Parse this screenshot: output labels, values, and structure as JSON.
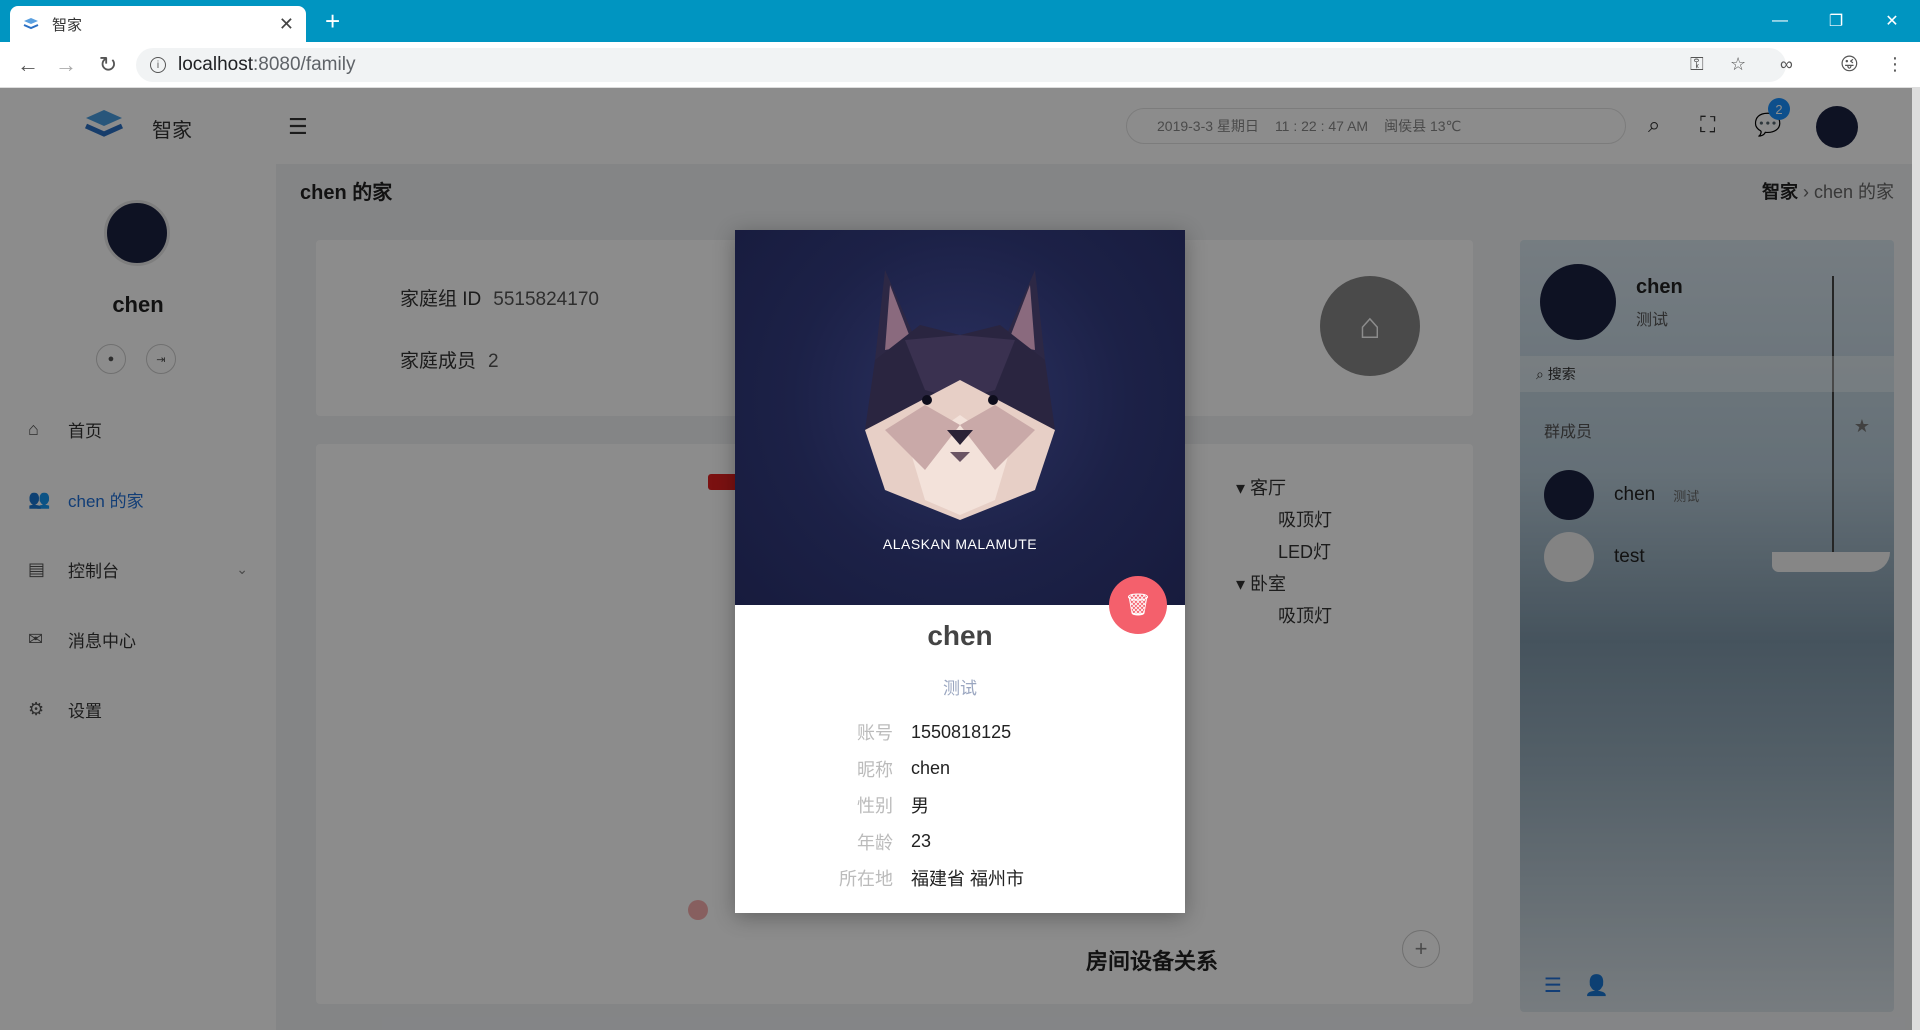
{
  "browser": {
    "tab_title": "智家",
    "url_host": "localhost",
    "url_rest": ":8080/family"
  },
  "header": {
    "app_name": "智家",
    "date": "2019-3-3 星期日",
    "time": "11 : 22 : 47 AM",
    "weather": "闽侯县  13℃",
    "message_count": "2"
  },
  "sidebar": {
    "user_name": "chen",
    "items": [
      {
        "label": "首页",
        "icon": "home-icon"
      },
      {
        "label": "chen 的家",
        "icon": "family-icon"
      },
      {
        "label": "控制台",
        "icon": "briefcase-icon"
      },
      {
        "label": "消息中心",
        "icon": "mail-icon"
      },
      {
        "label": "设置",
        "icon": "gear-icon"
      }
    ]
  },
  "page": {
    "title": "chen 的家",
    "breadcrumb_root": "智家",
    "breadcrumb_current": "chen 的家",
    "family_id_label": "家庭组 ID",
    "family_id_value": "5515824170",
    "members_label": "家庭成员",
    "members_value": "2",
    "room_section_title": "房间设备关系",
    "tree": {
      "room1": "客厅",
      "room1_devices": [
        "吸顶灯",
        "LED灯"
      ],
      "room2": "卧室",
      "room2_devices": [
        "吸顶灯"
      ]
    }
  },
  "chat": {
    "name": "chen",
    "status": "测试",
    "search_placeholder": "搜索",
    "group_label": "群成员",
    "members": [
      {
        "name": "chen",
        "tag": "测试"
      },
      {
        "name": "test",
        "tag": ""
      }
    ]
  },
  "modal": {
    "image_caption": "ALASKAN MALAMUTE",
    "name": "chen",
    "subtitle": "测试",
    "fields": [
      {
        "key": "账号",
        "value": "1550818125"
      },
      {
        "key": "昵称",
        "value": "chen"
      },
      {
        "key": "性别",
        "value": "男"
      },
      {
        "key": "年龄",
        "value": "23"
      },
      {
        "key": "所在地",
        "value": "福建省 福州市"
      }
    ]
  },
  "colors": {
    "chrome": "#0095c1",
    "accent": "#1f6fd8",
    "delete": "#f4606c"
  }
}
